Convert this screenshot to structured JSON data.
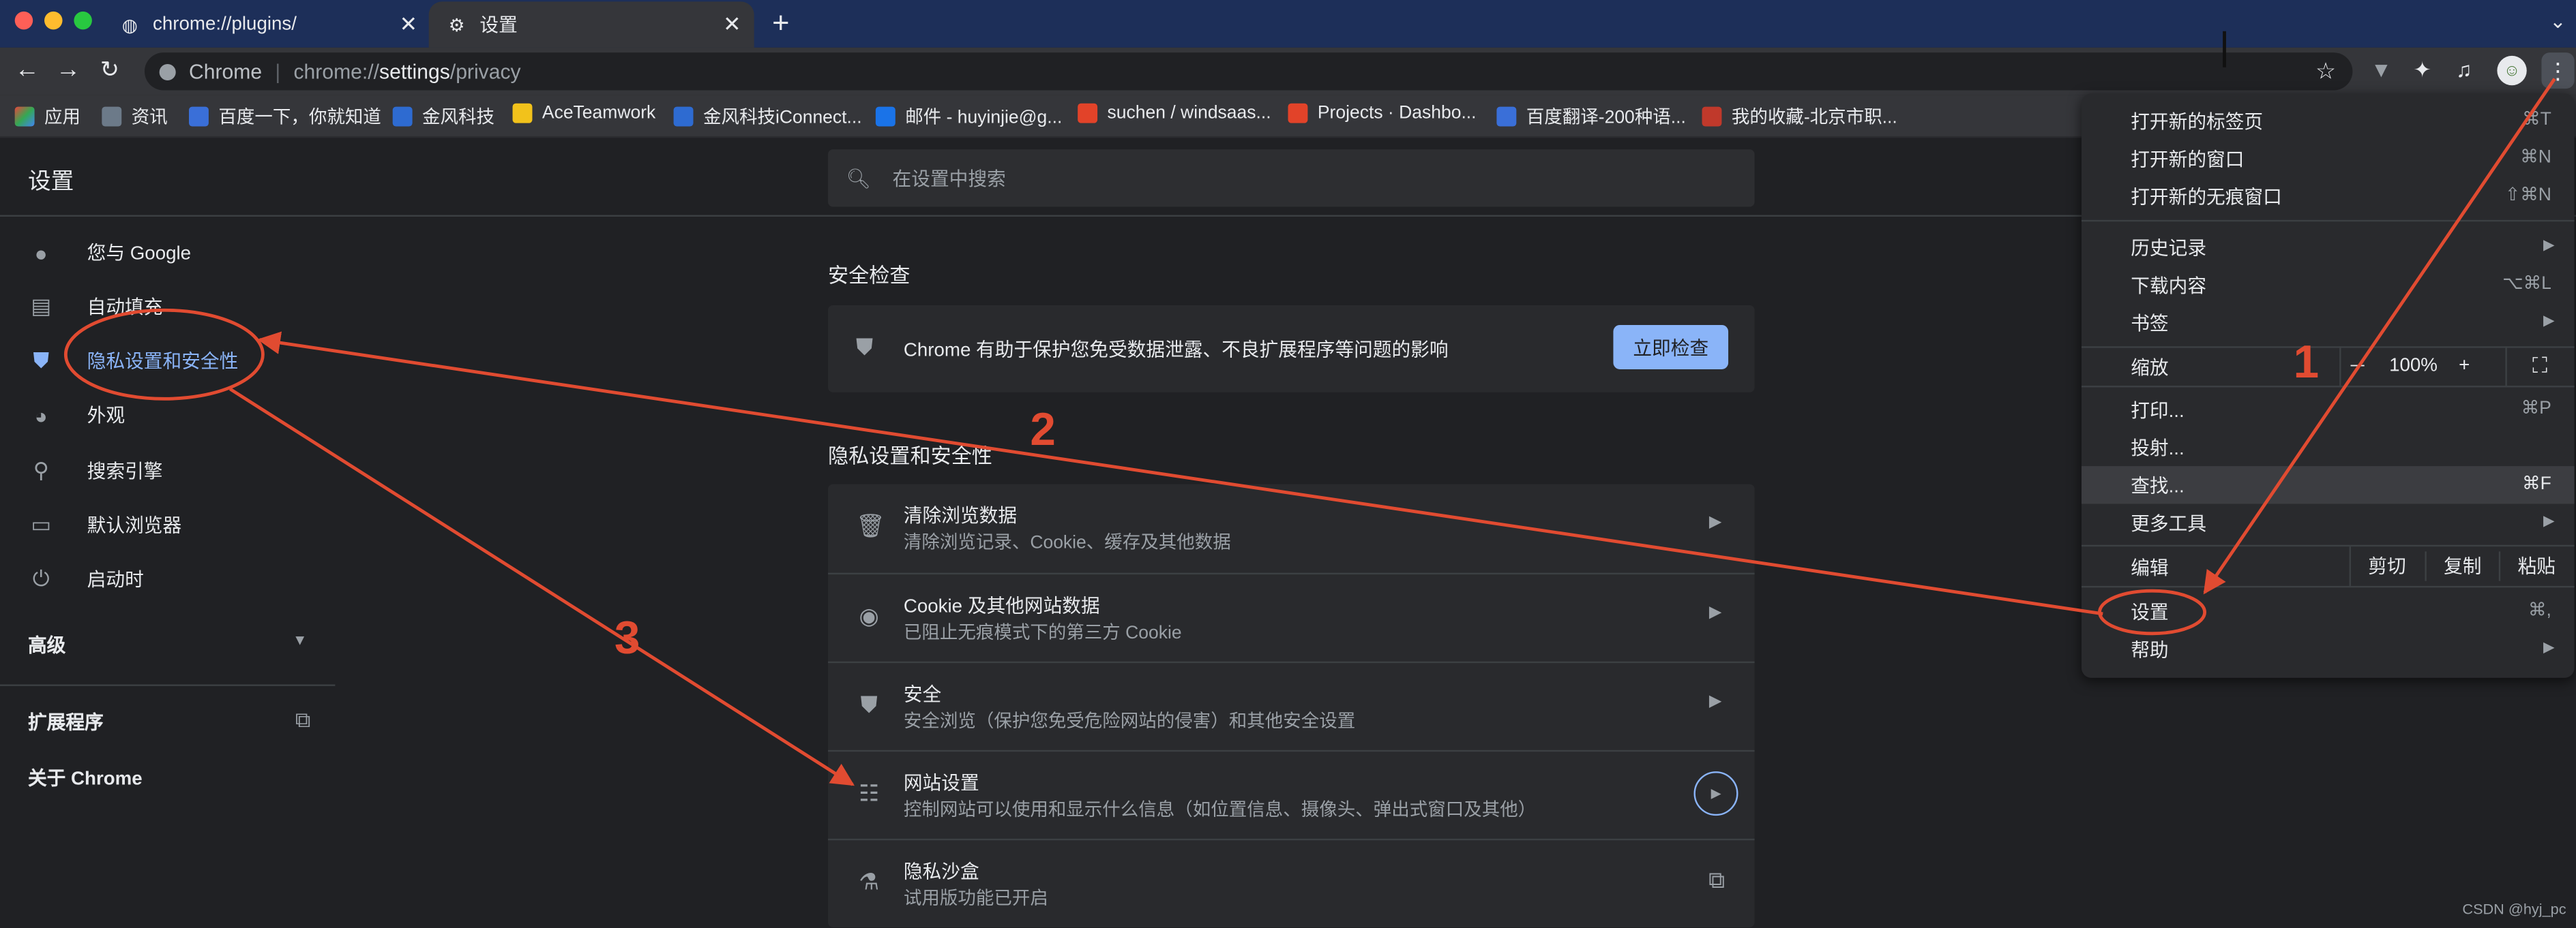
{
  "browser": {
    "tabs": [
      {
        "title": "chrome://plugins/",
        "active": false
      },
      {
        "title": "设置",
        "active": true
      }
    ],
    "omnibox": {
      "site_label": "Chrome",
      "url_dim": "chrome://",
      "url_bold": "settings",
      "url_rest": "/privacy"
    },
    "bookmarks": [
      {
        "label": "应用",
        "color": "#e8453c"
      },
      {
        "label": "资讯",
        "color": "#6c7a89"
      },
      {
        "label": "百度一下，你就知道",
        "color": "#3a6fd8"
      },
      {
        "label": "金风科技",
        "color": "#2e6bd1"
      },
      {
        "label": "AceTeamwork",
        "color": "#f2c21b"
      },
      {
        "label": "金风科技iConnect...",
        "color": "#2e6bd1"
      },
      {
        "label": "邮件 - huyinjie@g...",
        "color": "#1a73e8"
      },
      {
        "label": "suchen / windsaas...",
        "color": "#e24329"
      },
      {
        "label": "Projects · Dashbo...",
        "color": "#e24329"
      },
      {
        "label": "百度翻译-200种语...",
        "color": "#3a6fd8"
      },
      {
        "label": "我的收藏-北京市职...",
        "color": "#c0392b"
      }
    ],
    "icons": [
      "back-arrow",
      "forward-arrow",
      "reload",
      "star",
      "puzzle",
      "menu-dots"
    ]
  },
  "settings": {
    "page_title": "设置",
    "search_placeholder": "在设置中搜索",
    "sidebar": [
      {
        "label": "您与 Google",
        "icon": "person-icon"
      },
      {
        "label": "自动填充",
        "icon": "clipboard-icon"
      },
      {
        "label": "隐私设置和安全性",
        "icon": "shield-icon",
        "active": true
      },
      {
        "label": "外观",
        "icon": "palette-icon"
      },
      {
        "label": "搜索引擎",
        "icon": "search-icon"
      },
      {
        "label": "默认浏览器",
        "icon": "browser-icon"
      },
      {
        "label": "启动时",
        "icon": "power-icon"
      }
    ],
    "advanced": "高级",
    "extensions": "扩展程序",
    "about": "关于 Chrome",
    "safety_check": {
      "section_title": "安全检查",
      "text": "Chrome 有助于保护您免受数据泄露、不良扩展程序等问题的影响",
      "button": "立即检查"
    },
    "privacy": {
      "section_title": "隐私设置和安全性",
      "rows": [
        {
          "title": "清除浏览数据",
          "subtitle": "清除浏览记录、Cookie、缓存及其他数据",
          "icon": "trash-icon"
        },
        {
          "title": "Cookie 及其他网站数据",
          "subtitle": "已阻止无痕模式下的第三方 Cookie",
          "icon": "cookie-icon"
        },
        {
          "title": "安全",
          "subtitle": "安全浏览（保护您免受危险网站的侵害）和其他安全设置",
          "icon": "shield-icon"
        },
        {
          "title": "网站设置",
          "subtitle": "控制网站可以使用和显示什么信息（如位置信息、摄像头、弹出式窗口及其他）",
          "icon": "sliders-icon"
        },
        {
          "title": "隐私沙盒",
          "subtitle": "试用版功能已开启",
          "icon": "flask-icon"
        }
      ]
    }
  },
  "menu": {
    "new_tab": {
      "label": "打开新的标签页",
      "shortcut": "⌘T"
    },
    "new_window": {
      "label": "打开新的窗口",
      "shortcut": "⌘N"
    },
    "incognito": {
      "label": "打开新的无痕窗口",
      "shortcut": "⇧⌘N"
    },
    "history": {
      "label": "历史记录"
    },
    "downloads": {
      "label": "下载内容",
      "shortcut": "⌥⌘L"
    },
    "bookmarks": {
      "label": "书签"
    },
    "zoom": {
      "label": "缩放",
      "minus": "－",
      "value": "100%",
      "plus": "+"
    },
    "print": {
      "label": "打印...",
      "shortcut": "⌘P"
    },
    "cast": {
      "label": "投射..."
    },
    "find": {
      "label": "查找...",
      "shortcut": "⌘F"
    },
    "more_tools": {
      "label": "更多工具"
    },
    "edit": {
      "label": "编辑",
      "cut": "剪切",
      "copy": "复制",
      "paste": "粘贴"
    },
    "settings": {
      "label": "设置",
      "shortcut": "⌘,"
    },
    "help": {
      "label": "帮助"
    }
  },
  "annotations": {
    "step1": "1",
    "step2": "2",
    "step3": "3",
    "color": "#e14b31"
  },
  "watermark": "CSDN @hyj_pc"
}
